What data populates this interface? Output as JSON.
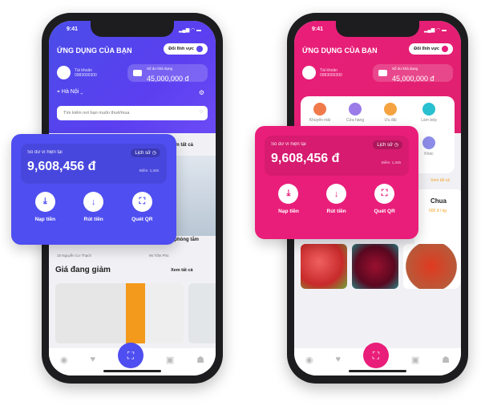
{
  "colors": {
    "primary_blue": "#4f4ef0",
    "primary_pink": "#e91e7a",
    "price_orange": "#f0a020"
  },
  "status": {
    "time": "9:41"
  },
  "header": {
    "app_title": "ỨNG DỤNG CỦA BẠN",
    "switch_label": "Đổi lĩnh vực",
    "account_label": "Tài khoản",
    "account_number": "0983000300",
    "available_label": "Số dư khả dụng",
    "available_amount": "45,000,000 đ",
    "location": "Hà Nội",
    "search_placeholder": "Tìm kiếm nơi bạn muốn thuê/mua"
  },
  "wallet": {
    "label": "Số dư ví hiện tại",
    "amount": "9,608,456 đ",
    "history": "Lịch sử",
    "points": "Điểm: 1,345",
    "actions": [
      {
        "label": "Nạp tiền",
        "icon": "download-icon"
      },
      {
        "label": "Rút tiền",
        "icon": "withdraw-icon"
      },
      {
        "label": "Quét QR",
        "icon": "qr-scan-icon"
      }
    ]
  },
  "phone1": {
    "see_all": "Xem tất cả",
    "listing_snippet": ", 1 phòng tắm",
    "addresses": [
      "15 Nguyễn Cư Thạch",
      "96 Trần Phú"
    ],
    "section_title": "Giá đang giảm",
    "section_see_all": "Xem tất cả"
  },
  "phone2": {
    "categories": [
      "Khuyến mãi",
      "Cửa hàng",
      "Ưu đãi",
      "Làm bếp",
      "Khác"
    ],
    "see_all": "Xem tất cả",
    "product_name": "Chua",
    "product_price": "000 đ / kg"
  },
  "tabbar": [
    "chat-icon",
    "heart-icon",
    "scan-icon",
    "bag-icon",
    "user-icon"
  ]
}
